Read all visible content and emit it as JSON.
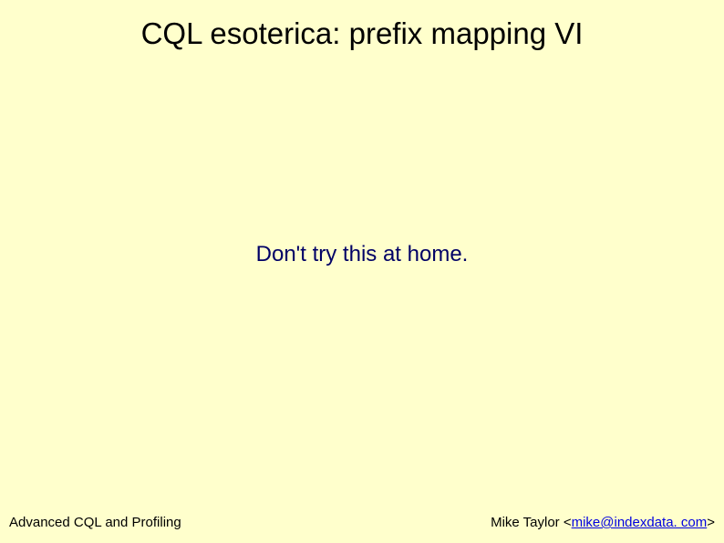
{
  "slide": {
    "title": "CQL esoterica: prefix mapping VI",
    "body": "Don't try this at home.",
    "footer_left": "Advanced CQL and Profiling",
    "footer_right_author": "Mike Taylor ",
    "footer_right_email": "mike@indexdata. com",
    "footer_right_lt": "<",
    "footer_right_gt": ">"
  }
}
